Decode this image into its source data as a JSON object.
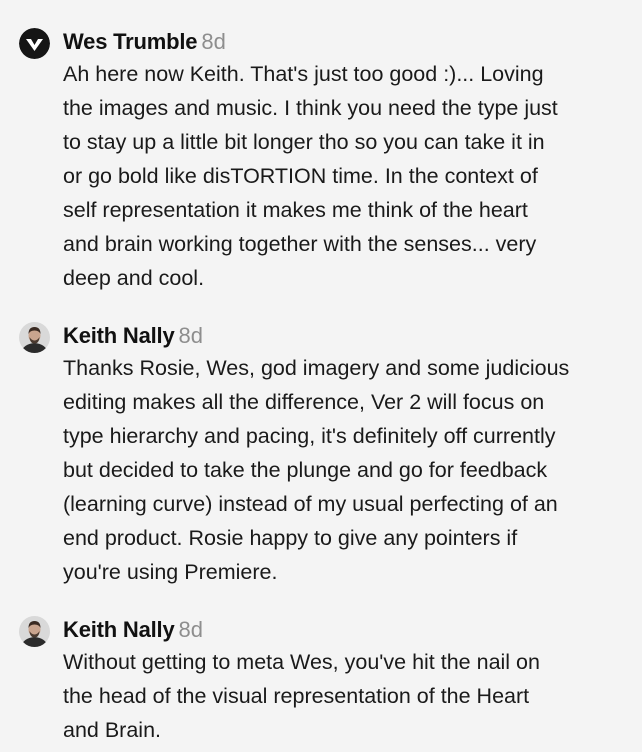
{
  "comments": [
    {
      "author": "Wes Trumble",
      "time": "8d",
      "avatar_icon": "wes-logo-icon",
      "lines": [
        "Ah here now Keith. That's just too good :)... Loving",
        "the images and music. I think you need the type just",
        "to stay up a little bit longer tho so you can take it in",
        "or go bold like disTORTION time. In the context of",
        "self representation it makes me think of the heart",
        "and brain working together with the senses... very",
        "deep and cool."
      ]
    },
    {
      "author": "Keith Nally",
      "time": "8d",
      "avatar_icon": "keith-avatar-icon",
      "lines": [
        "Thanks Rosie, Wes, god imagery and some judicious",
        "editing makes all the difference, Ver 2 will focus on",
        "type hierarchy and pacing, it's definitely off currently",
        "but decided to take the plunge and go for feedback",
        "(learning curve) instead of my usual perfecting of an",
        "end product. Rosie happy to give any pointers if",
        "you're using Premiere."
      ]
    },
    {
      "author": "Keith Nally",
      "time": "8d",
      "avatar_icon": "keith-avatar-icon",
      "lines": [
        "Without getting to meta Wes, you've hit the nail on",
        "the head of the visual representation of the Heart",
        "and Brain."
      ]
    }
  ]
}
